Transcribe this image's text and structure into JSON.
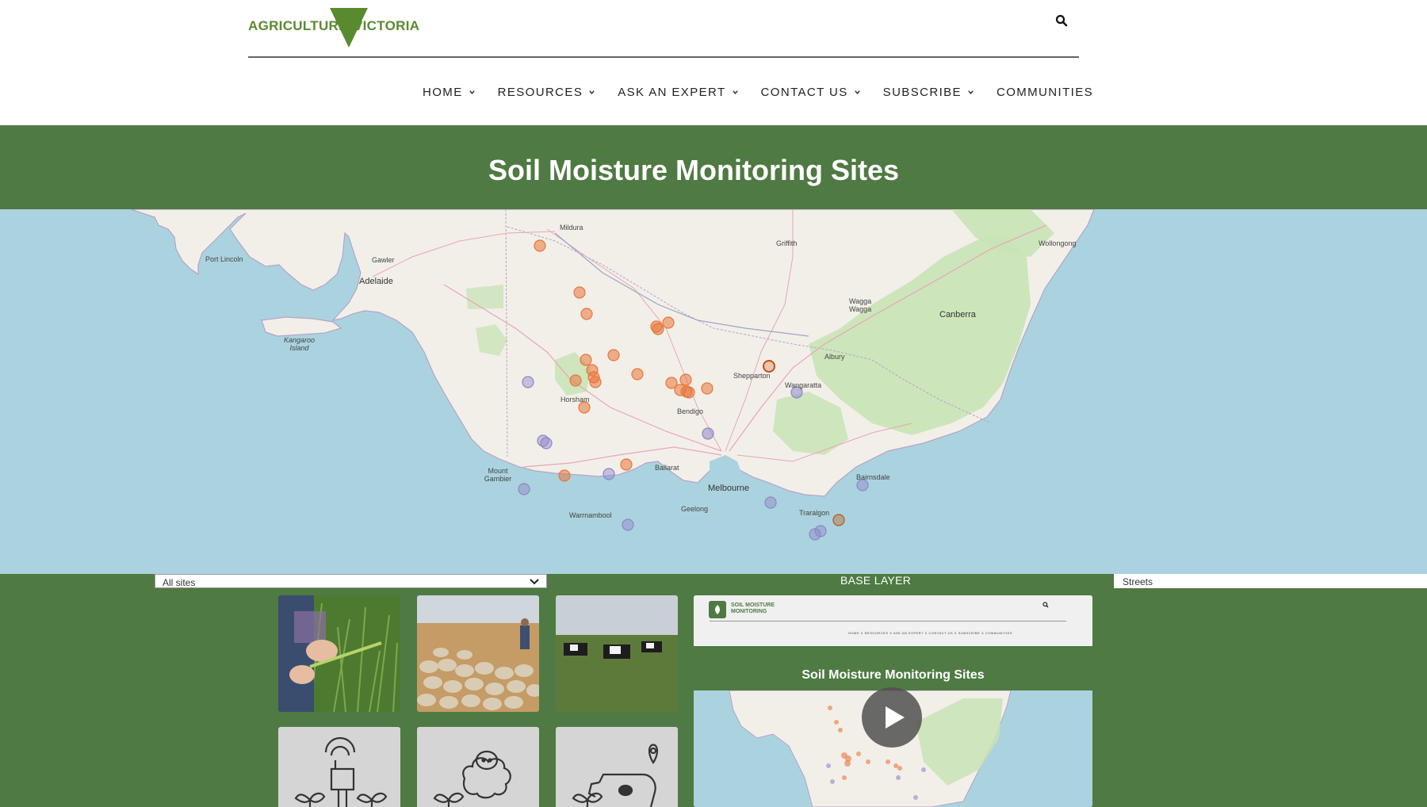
{
  "brand": {
    "logo_left": "AGRICULTURE",
    "logo_right": "VICTORIA",
    "green": "#5a8a2f",
    "band_green": "#4f7a43"
  },
  "header": {
    "search_icon": "search-icon"
  },
  "nav": {
    "items": [
      {
        "label": "HOME",
        "has_dropdown": true
      },
      {
        "label": "RESOURCES",
        "has_dropdown": true
      },
      {
        "label": "ASK AN EXPERT",
        "has_dropdown": true
      },
      {
        "label": "CONTACT US",
        "has_dropdown": true
      },
      {
        "label": "SUBSCRIBE",
        "has_dropdown": true
      },
      {
        "label": "COMMUNITIES",
        "has_dropdown": false
      }
    ]
  },
  "page": {
    "title": "Soil Moisture Monitoring Sites"
  },
  "map": {
    "places": [
      "Mildura",
      "Griffith",
      "Port Lincoln",
      "Gawler",
      "Adelaide",
      "Wagga Wagga",
      "Canberra",
      "Wollongong",
      "Kangaroo Island",
      "Albury",
      "Shepparton",
      "Wangaratta",
      "Horsham",
      "Bendigo",
      "Ballarat",
      "Mount Gambier",
      "Melbourne",
      "Bairnsdale",
      "Geelong",
      "Traralgon",
      "Warrnambool"
    ],
    "marker_colors": {
      "orange": "#e8773a",
      "purple": "#8f86c8",
      "dark": "#c0501e"
    }
  },
  "controls": {
    "sites_select_value": "All sites",
    "base_layer_label": "BASE LAYER",
    "base_layer_value": "Streets"
  },
  "video": {
    "mini_logo_line1": "SOIL MOISTURE",
    "mini_logo_line2": "MONITORING",
    "mini_nav": "HOME ∨   RESOURCES ∨   ASK AN EXPERT ∨   CONTACT US ∨   SUBSCRIBE ∨   COMMUNITIES",
    "title": "Soil Moisture Monitoring Sites"
  }
}
